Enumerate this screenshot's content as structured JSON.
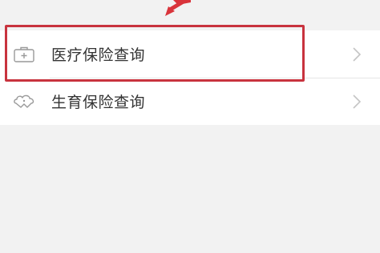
{
  "menu": {
    "items": [
      {
        "label": "医疗保险查询",
        "icon": "medical-kit-icon",
        "highlighted": true
      },
      {
        "label": "生育保险查询",
        "icon": "baby-cloud-icon",
        "highlighted": false
      }
    ]
  },
  "annotation": {
    "arrow_color": "#d9343b",
    "box_color": "#c8333e"
  }
}
